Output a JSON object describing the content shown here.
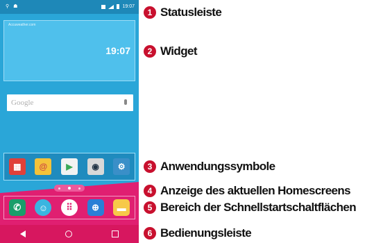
{
  "statusbar": {
    "time": "19:07"
  },
  "widget": {
    "label": "Accuweather.com",
    "time": "19:07"
  },
  "search": {
    "placeholder": "Google"
  },
  "apps": [
    {
      "icon": "games-icon",
      "glyph": "▦",
      "color": "#e0403a"
    },
    {
      "icon": "email-icon",
      "glyph": "@",
      "color": "#f4c23a"
    },
    {
      "icon": "play-store-icon",
      "glyph": "▶",
      "color": "#f2f2f2"
    },
    {
      "icon": "camera-icon",
      "glyph": "◉",
      "color": "#d8d8d8"
    },
    {
      "icon": "settings-icon",
      "glyph": "⚙",
      "color": "#3a8fc8"
    }
  ],
  "quick_access": [
    {
      "icon": "phone-icon",
      "glyph": "✆",
      "color": "#1a9e6a"
    },
    {
      "icon": "contacts-icon",
      "glyph": "☺",
      "color": "#3ab5e0"
    },
    {
      "icon": "apps-icon",
      "glyph": "⠿",
      "color": "#e01f71"
    },
    {
      "icon": "browser-icon",
      "glyph": "⊕",
      "color": "#2a7fd6"
    },
    {
      "icon": "messaging-icon",
      "glyph": "▬",
      "color": "#f7c948"
    }
  ],
  "callouts": [
    {
      "number": "1",
      "label": "Statusleiste"
    },
    {
      "number": "2",
      "label": "Widget"
    },
    {
      "number": "3",
      "label": "Anwendungssymbole"
    },
    {
      "number": "4",
      "label": "Anzeige des aktuellen Homescreens"
    },
    {
      "number": "5",
      "label": "Bereich der Schnellstartschaltflächen"
    },
    {
      "number": "6",
      "label": "Bedienungsleiste"
    }
  ],
  "colors": {
    "badge": "#c8102e",
    "screen": "#2aa6d8",
    "accent": "#e01f71"
  }
}
